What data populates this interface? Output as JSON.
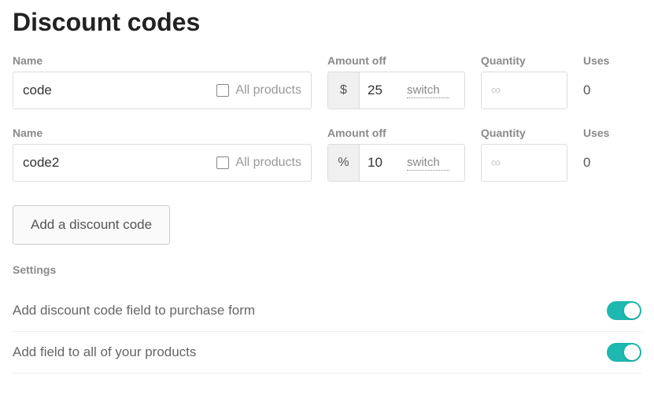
{
  "title": "Discount codes",
  "columns": {
    "name": "Name",
    "amount": "Amount off",
    "quantity": "Quantity",
    "uses": "Uses"
  },
  "allProductsLabel": "All products",
  "switchLabel": "switch",
  "quantityPlaceholder": "∞",
  "codes": [
    {
      "name": "code",
      "allProducts": false,
      "currencySymbol": "$",
      "amount": "25",
      "quantity": "",
      "uses": "0"
    },
    {
      "name": "code2",
      "allProducts": false,
      "currencySymbol": "%",
      "amount": "10",
      "quantity": "",
      "uses": "0"
    }
  ],
  "addButton": "Add a discount code",
  "settingsHeading": "Settings",
  "settings": [
    {
      "label": "Add discount code field to purchase form",
      "on": true
    },
    {
      "label": "Add field to all of your products",
      "on": true
    }
  ]
}
